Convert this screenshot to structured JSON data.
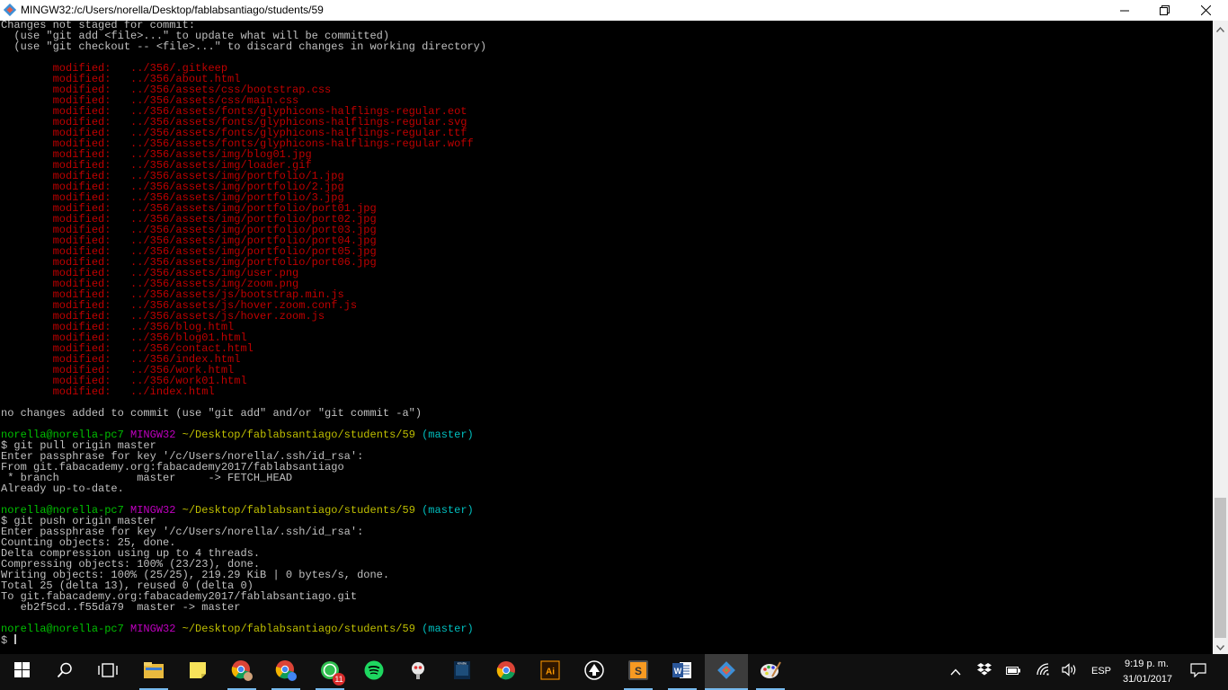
{
  "window": {
    "title": "MINGW32:/c/Users/norella/Desktop/fablabsantiago/students/59",
    "minimize_icon": "minimize-icon",
    "maximize_icon": "restore-icon",
    "close_icon": "close-icon"
  },
  "terminal": {
    "lines": [
      [
        {
          "t": "Changes not staged for commit:",
          "c": ""
        }
      ],
      [
        {
          "t": "  (use \"git add <file>...\" to update what will be committed)",
          "c": ""
        }
      ],
      [
        {
          "t": "  (use \"git checkout -- <file>...\" to discard changes in working directory)",
          "c": ""
        }
      ],
      [],
      [
        {
          "t": "        modified:   ../356/.gitkeep",
          "c": "red"
        }
      ],
      [
        {
          "t": "        modified:   ../356/about.html",
          "c": "red"
        }
      ],
      [
        {
          "t": "        modified:   ../356/assets/css/bootstrap.css",
          "c": "red"
        }
      ],
      [
        {
          "t": "        modified:   ../356/assets/css/main.css",
          "c": "red"
        }
      ],
      [
        {
          "t": "        modified:   ../356/assets/fonts/glyphicons-halflings-regular.eot",
          "c": "red"
        }
      ],
      [
        {
          "t": "        modified:   ../356/assets/fonts/glyphicons-halflings-regular.svg",
          "c": "red"
        }
      ],
      [
        {
          "t": "        modified:   ../356/assets/fonts/glyphicons-halflings-regular.ttf",
          "c": "red"
        }
      ],
      [
        {
          "t": "        modified:   ../356/assets/fonts/glyphicons-halflings-regular.woff",
          "c": "red"
        }
      ],
      [
        {
          "t": "        modified:   ../356/assets/img/blog01.jpg",
          "c": "red"
        }
      ],
      [
        {
          "t": "        modified:   ../356/assets/img/loader.gif",
          "c": "red"
        }
      ],
      [
        {
          "t": "        modified:   ../356/assets/img/portfolio/1.jpg",
          "c": "red"
        }
      ],
      [
        {
          "t": "        modified:   ../356/assets/img/portfolio/2.jpg",
          "c": "red"
        }
      ],
      [
        {
          "t": "        modified:   ../356/assets/img/portfolio/3.jpg",
          "c": "red"
        }
      ],
      [
        {
          "t": "        modified:   ../356/assets/img/portfolio/port01.jpg",
          "c": "red"
        }
      ],
      [
        {
          "t": "        modified:   ../356/assets/img/portfolio/port02.jpg",
          "c": "red"
        }
      ],
      [
        {
          "t": "        modified:   ../356/assets/img/portfolio/port03.jpg",
          "c": "red"
        }
      ],
      [
        {
          "t": "        modified:   ../356/assets/img/portfolio/port04.jpg",
          "c": "red"
        }
      ],
      [
        {
          "t": "        modified:   ../356/assets/img/portfolio/port05.jpg",
          "c": "red"
        }
      ],
      [
        {
          "t": "        modified:   ../356/assets/img/portfolio/port06.jpg",
          "c": "red"
        }
      ],
      [
        {
          "t": "        modified:   ../356/assets/img/user.png",
          "c": "red"
        }
      ],
      [
        {
          "t": "        modified:   ../356/assets/img/zoom.png",
          "c": "red"
        }
      ],
      [
        {
          "t": "        modified:   ../356/assets/js/bootstrap.min.js",
          "c": "red"
        }
      ],
      [
        {
          "t": "        modified:   ../356/assets/js/hover.zoom.conf.js",
          "c": "red"
        }
      ],
      [
        {
          "t": "        modified:   ../356/assets/js/hover.zoom.js",
          "c": "red"
        }
      ],
      [
        {
          "t": "        modified:   ../356/blog.html",
          "c": "red"
        }
      ],
      [
        {
          "t": "        modified:   ../356/blog01.html",
          "c": "red"
        }
      ],
      [
        {
          "t": "        modified:   ../356/contact.html",
          "c": "red"
        }
      ],
      [
        {
          "t": "        modified:   ../356/index.html",
          "c": "red"
        }
      ],
      [
        {
          "t": "        modified:   ../356/work.html",
          "c": "red"
        }
      ],
      [
        {
          "t": "        modified:   ../356/work01.html",
          "c": "red"
        }
      ],
      [
        {
          "t": "        modified:   ../index.html",
          "c": "red"
        }
      ],
      [],
      [
        {
          "t": "no changes added to commit (use \"git add\" and/or \"git commit -a\")",
          "c": ""
        }
      ],
      [],
      [
        {
          "t": "norella@norella-pc7",
          "c": "grn"
        },
        {
          "t": " ",
          "c": ""
        },
        {
          "t": "MINGW32",
          "c": "mag"
        },
        {
          "t": " ",
          "c": ""
        },
        {
          "t": "~/Desktop/fablabsantiago/students/59",
          "c": "yel"
        },
        {
          "t": " ",
          "c": ""
        },
        {
          "t": "(master)",
          "c": "cyn"
        }
      ],
      [
        {
          "t": "$ git pull origin master",
          "c": ""
        }
      ],
      [
        {
          "t": "Enter passphrase for key '/c/Users/norella/.ssh/id_rsa':",
          "c": ""
        }
      ],
      [
        {
          "t": "From git.fabacademy.org:fabacademy2017/fablabsantiago",
          "c": ""
        }
      ],
      [
        {
          "t": " * branch            master     -> FETCH_HEAD",
          "c": ""
        }
      ],
      [
        {
          "t": "Already up-to-date.",
          "c": ""
        }
      ],
      [],
      [
        {
          "t": "norella@norella-pc7",
          "c": "grn"
        },
        {
          "t": " ",
          "c": ""
        },
        {
          "t": "MINGW32",
          "c": "mag"
        },
        {
          "t": " ",
          "c": ""
        },
        {
          "t": "~/Desktop/fablabsantiago/students/59",
          "c": "yel"
        },
        {
          "t": " ",
          "c": ""
        },
        {
          "t": "(master)",
          "c": "cyn"
        }
      ],
      [
        {
          "t": "$ git push origin master",
          "c": ""
        }
      ],
      [
        {
          "t": "Enter passphrase for key '/c/Users/norella/.ssh/id_rsa':",
          "c": ""
        }
      ],
      [
        {
          "t": "Counting objects: 25, done.",
          "c": ""
        }
      ],
      [
        {
          "t": "Delta compression using up to 4 threads.",
          "c": ""
        }
      ],
      [
        {
          "t": "Compressing objects: 100% (23/23), done.",
          "c": ""
        }
      ],
      [
        {
          "t": "Writing objects: 100% (25/25), 219.29 KiB | 0 bytes/s, done.",
          "c": ""
        }
      ],
      [
        {
          "t": "Total 25 (delta 13), reused 0 (delta 0)",
          "c": ""
        }
      ],
      [
        {
          "t": "To git.fabacademy.org:fabacademy2017/fablabsantiago.git",
          "c": ""
        }
      ],
      [
        {
          "t": "   eb2f5cd..f55da79  master -> master",
          "c": ""
        }
      ],
      [],
      [
        {
          "t": "norella@norella-pc7",
          "c": "grn"
        },
        {
          "t": " ",
          "c": ""
        },
        {
          "t": "MINGW32",
          "c": "mag"
        },
        {
          "t": " ",
          "c": ""
        },
        {
          "t": "~/Desktop/fablabsantiago/students/59",
          "c": "yel"
        },
        {
          "t": " ",
          "c": ""
        },
        {
          "t": "(master)",
          "c": "cyn"
        }
      ],
      [
        {
          "t": "$ ",
          "c": ""
        },
        {
          "cursor": true
        }
      ]
    ]
  },
  "colors": {
    "modified": "#bf0000",
    "prompt_user": "#00bf00",
    "prompt_system": "#bf00bf",
    "prompt_path": "#bfbf00",
    "prompt_branch": "#00bfbf",
    "taskbar_accent": "#76b9ed"
  },
  "taskbar": {
    "start_icon": "windows-start-icon",
    "search_icon": "search-icon",
    "task_view_icon": "task-view-icon",
    "apps": [
      {
        "name": "file-explorer-icon"
      },
      {
        "name": "sticky-notes-icon"
      },
      {
        "name": "chrome-user-icon"
      },
      {
        "name": "chrome-user-icon"
      },
      {
        "name": "whatsapp-icon",
        "badge": "11"
      },
      {
        "name": "spotify-icon"
      },
      {
        "name": "app-icon"
      },
      {
        "name": "kindle-icon"
      },
      {
        "name": "chrome-icon"
      },
      {
        "name": "illustrator-icon"
      },
      {
        "name": "inkscape-icon"
      },
      {
        "name": "sublime-text-icon"
      },
      {
        "name": "word-icon"
      },
      {
        "name": "git-bash-icon"
      },
      {
        "name": "paint-icon"
      }
    ],
    "tray": {
      "chevron_icon": "chevron-up-icon",
      "dropbox_icon": "dropbox-icon",
      "battery_icon": "battery-icon",
      "wifi_icon": "wifi-icon",
      "volume_icon": "volume-icon",
      "language": "ESP",
      "time": "9:19 p. m.",
      "date": "31/01/2017",
      "notifications_icon": "action-center-icon"
    }
  }
}
